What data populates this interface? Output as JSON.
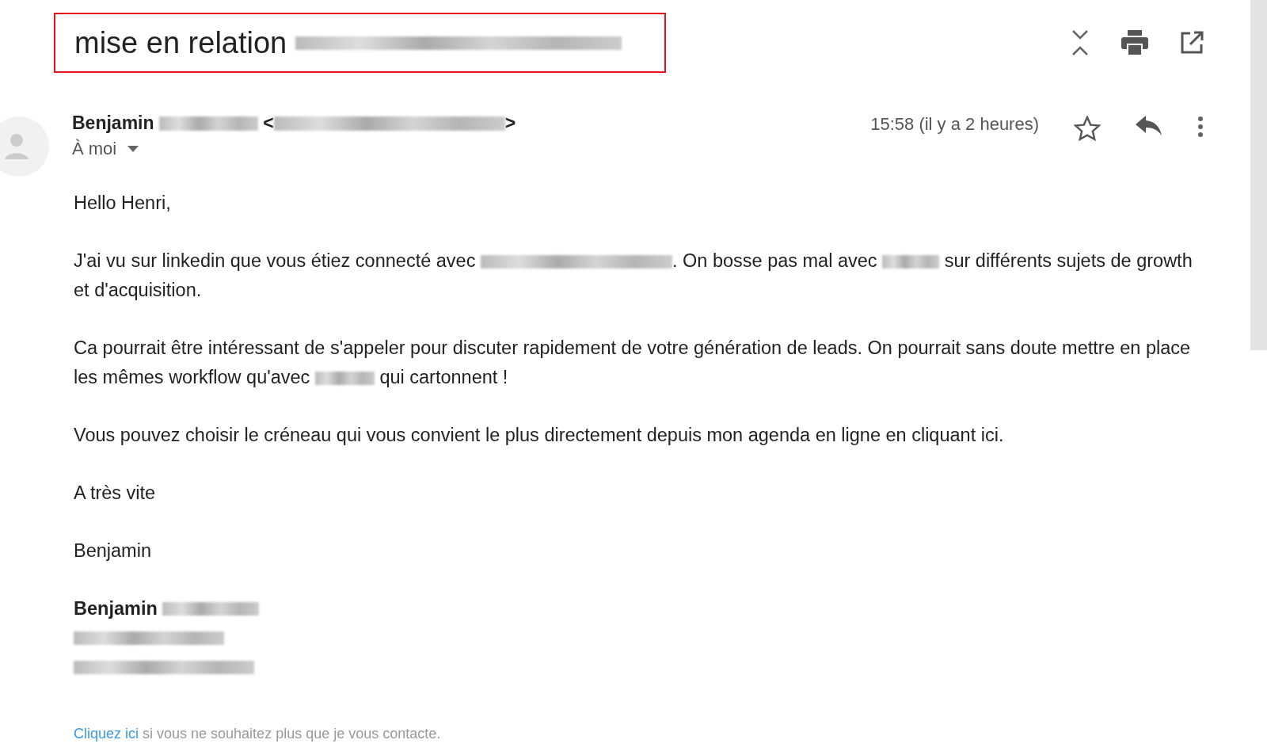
{
  "subject": [
    {
      "kind": "text",
      "text": "mise en relation "
    },
    {
      "kind": "redacted"
    }
  ],
  "sender": [
    {
      "kind": "text",
      "text": "Benjamin "
    },
    {
      "kind": "redacted"
    },
    {
      "kind": "text",
      "text": " <"
    },
    {
      "kind": "redacted"
    },
    {
      "kind": "text",
      "text": ">"
    }
  ],
  "recipient": "À moi",
  "time": "15:58 (il y a 2 heures)",
  "starred": false,
  "paragraphs": [
    [
      {
        "kind": "text",
        "text": "Hello Henri,"
      }
    ],
    [
      {
        "kind": "text",
        "text": "J'ai vu sur linkedin que vous étiez connecté avec "
      },
      {
        "kind": "redacted"
      },
      {
        "kind": "text",
        "text": ". On bosse pas mal avec "
      },
      {
        "kind": "redacted"
      },
      {
        "kind": "text",
        "text": " sur différents sujets de growth et d'acquisition."
      }
    ],
    [
      {
        "kind": "text",
        "text": "Ca pourrait être intéressant de s'appeler pour discuter rapidement de votre génération de leads. On pourrait sans doute mettre en place les mêmes workflow qu'avec "
      },
      {
        "kind": "redacted"
      },
      {
        "kind": "text",
        "text": " qui cartonnent !"
      }
    ],
    [
      {
        "kind": "text",
        "text": "Vous pouvez choisir le créneau qui vous convient le plus directement depuis mon agenda en ligne en cliquant ici."
      }
    ],
    [
      {
        "kind": "text",
        "text": "A très vite"
      }
    ],
    [
      {
        "kind": "text",
        "text": "Benjamin"
      }
    ]
  ],
  "signature": [
    [
      {
        "kind": "bold",
        "text": "Benjamin "
      },
      {
        "kind": "redacted"
      }
    ],
    [
      {
        "kind": "redacted"
      }
    ],
    [
      {
        "kind": "redacted"
      }
    ]
  ],
  "footer": {
    "link": "Cliquez ici",
    "text": " si vous ne souhaitez plus que je vous contacte."
  }
}
